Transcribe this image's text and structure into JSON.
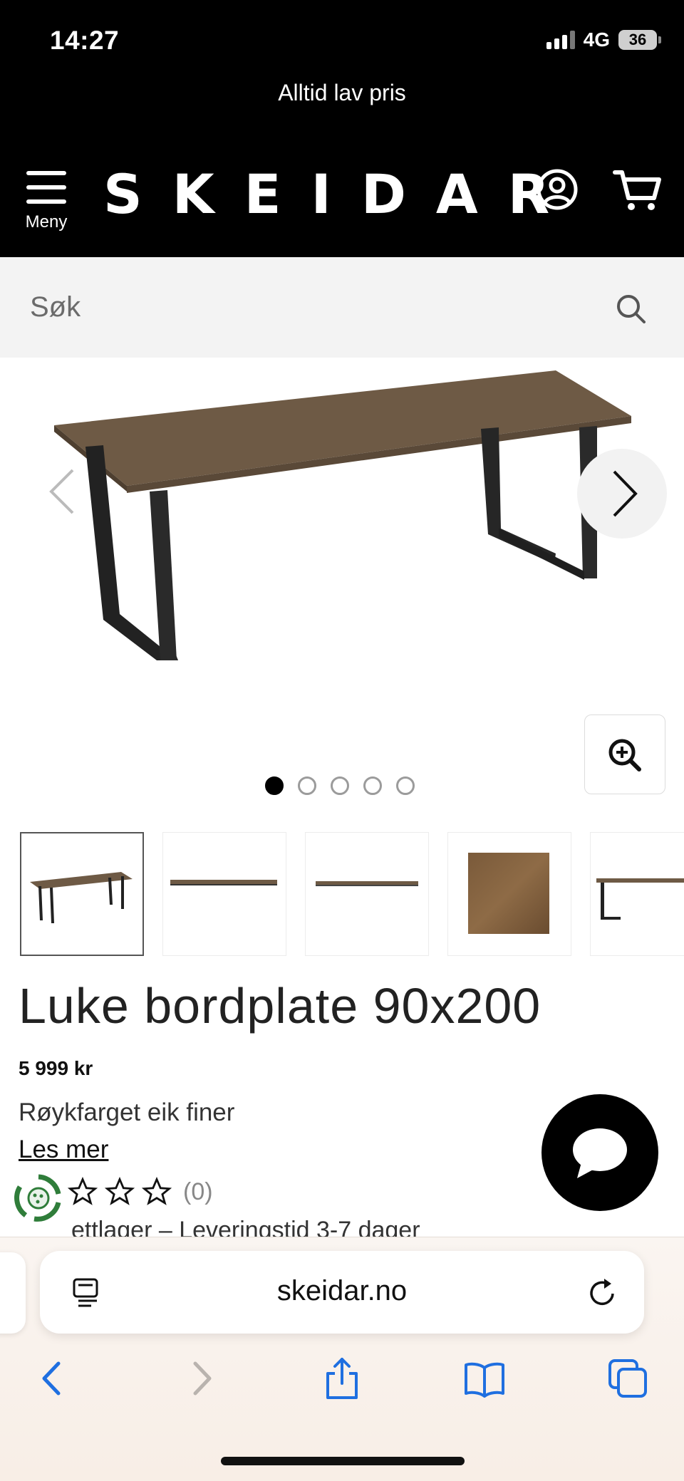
{
  "status_bar": {
    "time": "14:27",
    "network": "4G",
    "battery": "36"
  },
  "banner": {
    "text": "Alltid lav pris"
  },
  "header": {
    "menu_label": "Meny",
    "logo": "SKEIDAR"
  },
  "search": {
    "placeholder": "Søk"
  },
  "gallery": {
    "image_count": 5,
    "active_index": 0
  },
  "product": {
    "title": "Luke bordplate 90x200",
    "price": "5 999 kr",
    "variant": "Røykfarget eik finer",
    "read_more": "Les mer",
    "rating_count": "(0)",
    "stock": "ettlager – Leveringstid 3-7 dager"
  },
  "browser": {
    "url": "skeidar.no"
  },
  "colors": {
    "header_bg": "#000000",
    "search_bg": "#f3f3f3",
    "link_blue": "#1f6fe0",
    "eco_green": "#2f7d3a"
  },
  "icons": [
    "hamburger-icon",
    "user-icon",
    "cart-icon",
    "search-icon",
    "chevron-left-icon",
    "chevron-right-icon",
    "zoom-in-icon",
    "star-icon",
    "chat-icon",
    "eco-badge-icon",
    "reader-icon",
    "reload-icon",
    "back-icon",
    "forward-icon",
    "share-icon",
    "bookmarks-icon",
    "tabs-icon"
  ]
}
